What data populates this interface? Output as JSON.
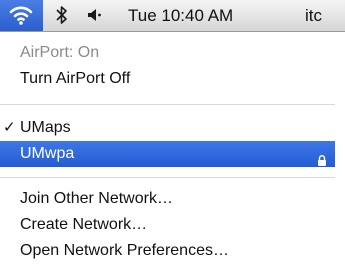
{
  "menubar": {
    "wifi_icon": "wifi-icon",
    "bluetooth_icon": "bluetooth-icon",
    "bluetooth_glyph": "✱",
    "volume_icon": "volume-icon",
    "volume_glyph": "◀•",
    "clock": "Tue 10:40 AM",
    "user_partial": "itc",
    "active_color": "#2b5fcf"
  },
  "menu": {
    "status": "AirPort: On",
    "toggle_label": "Turn AirPort Off",
    "networks": [
      {
        "name": "UMaps",
        "checked": true,
        "locked": false
      },
      {
        "name": "UMwpa",
        "checked": false,
        "locked": true,
        "highlighted": true
      }
    ],
    "check_glyph": "✓",
    "actions": [
      "Join Other Network…",
      "Create Network…",
      "Open Network Preferences…"
    ],
    "highlight_color": "#2f69dd"
  }
}
